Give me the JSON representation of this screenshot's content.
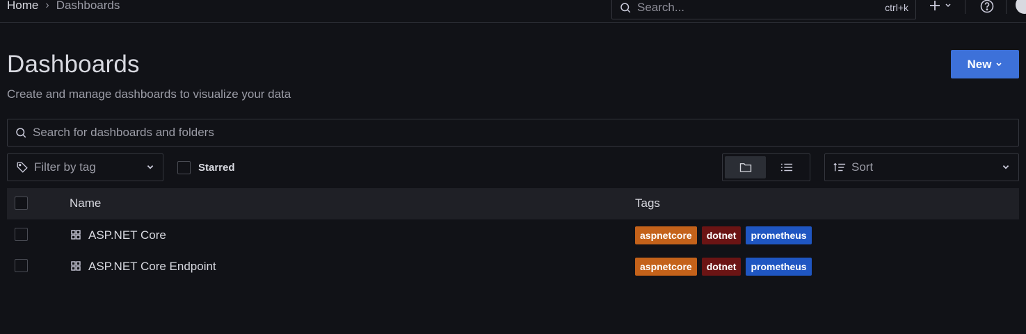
{
  "breadcrumb": {
    "home": "Home",
    "separator": "›",
    "current": "Dashboards"
  },
  "top_search": {
    "placeholder": "Search...",
    "shortcut": "ctrl+k"
  },
  "page": {
    "title": "Dashboards",
    "subtitle": "Create and manage dashboards to visualize your data",
    "new_button": "New"
  },
  "search": {
    "placeholder": "Search for dashboards and folders"
  },
  "filters": {
    "tag_placeholder": "Filter by tag",
    "starred_label": "Starred",
    "sort_placeholder": "Sort"
  },
  "table": {
    "headers": {
      "name": "Name",
      "tags": "Tags"
    },
    "rows": [
      {
        "title": "ASP.NET Core",
        "tags": [
          {
            "label": "aspnetcore",
            "color": "#c4621a"
          },
          {
            "label": "dotnet",
            "color": "#6b1414"
          },
          {
            "label": "prometheus",
            "color": "#1f56c2"
          }
        ]
      },
      {
        "title": "ASP.NET Core Endpoint",
        "tags": [
          {
            "label": "aspnetcore",
            "color": "#c4621a"
          },
          {
            "label": "dotnet",
            "color": "#6b1414"
          },
          {
            "label": "prometheus",
            "color": "#1f56c2"
          }
        ]
      }
    ]
  },
  "colors": {
    "accent": "#3d71d9",
    "background": "#111217",
    "header_bg": "#1f2026"
  }
}
